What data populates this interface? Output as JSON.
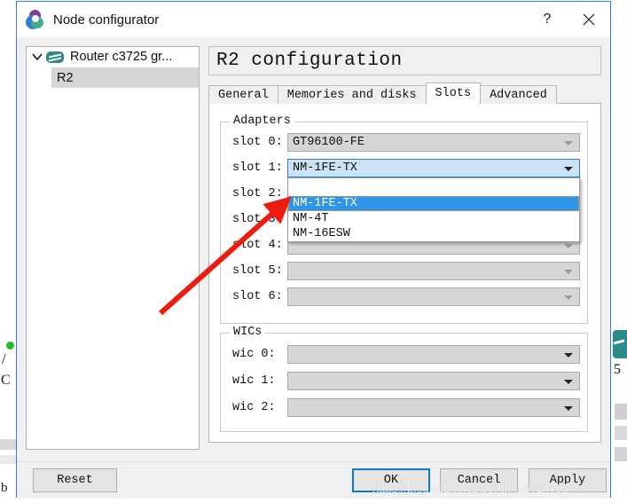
{
  "window": {
    "title": "Node configurator",
    "icon": "gns3-app-icon",
    "help_label": "?",
    "close_label": "✕"
  },
  "tree": {
    "root": {
      "label": "Router c3725 gr...",
      "icon": "router-icon",
      "expanded": true
    },
    "child": {
      "label": "R2",
      "selected": true
    }
  },
  "page": {
    "title": "R2 configuration"
  },
  "tabs": [
    {
      "label": "General",
      "active": false
    },
    {
      "label": "Memories and disks",
      "active": false
    },
    {
      "label": "Slots",
      "active": true
    },
    {
      "label": "Advanced",
      "active": false
    }
  ],
  "adapters": {
    "legend": "Adapters",
    "slots": [
      {
        "label": "slot 0:",
        "value": "GT96100-FE",
        "state": "readonly"
      },
      {
        "label": "slot 1:",
        "value": "NM-1FE-TX",
        "state": "open"
      },
      {
        "label": "slot 2:",
        "value": "",
        "state": "enabled"
      },
      {
        "label": "slot 3:",
        "value": "",
        "state": "enabled"
      },
      {
        "label": "slot 4:",
        "value": "",
        "state": "disabled"
      },
      {
        "label": "slot 5:",
        "value": "",
        "state": "disabled"
      },
      {
        "label": "slot 6:",
        "value": "",
        "state": "disabled"
      }
    ]
  },
  "dropdown": {
    "open_for": "slot 1:",
    "items": [
      {
        "label": "",
        "selected": false
      },
      {
        "label": "NM-1FE-TX",
        "selected": true
      },
      {
        "label": "NM-4T",
        "selected": false
      },
      {
        "label": "NM-16ESW",
        "selected": false
      }
    ]
  },
  "wics": {
    "legend": "WICs",
    "slots": [
      {
        "label": "wic 0:",
        "value": "",
        "state": "enabled"
      },
      {
        "label": "wic 1:",
        "value": "",
        "state": "enabled"
      },
      {
        "label": "wic 2:",
        "value": "",
        "state": "enabled"
      }
    ]
  },
  "footer": {
    "reset": "Reset",
    "ok": "OK",
    "cancel": "Cancel",
    "apply": "Apply"
  },
  "annotation": {
    "type": "red-arrow",
    "color": "#ee1c10",
    "from": [
      181,
      353
    ],
    "to": [
      322,
      228
    ]
  },
  "watermark": {
    "text": "https://blog.csdn.net/weixin_45724795"
  },
  "backdrop": {
    "slash": "/",
    "letter_c": "C",
    "bottom_text": "b",
    "right_digit": "5"
  },
  "colors": {
    "accent": "#0a79d6",
    "window_border": "#2b7dd6",
    "highlight": "#2e95e8",
    "combo_open_bg": "#cce2f7",
    "disabled_bg": "#d6d6d6",
    "router_teal": "#2e8b8b"
  }
}
